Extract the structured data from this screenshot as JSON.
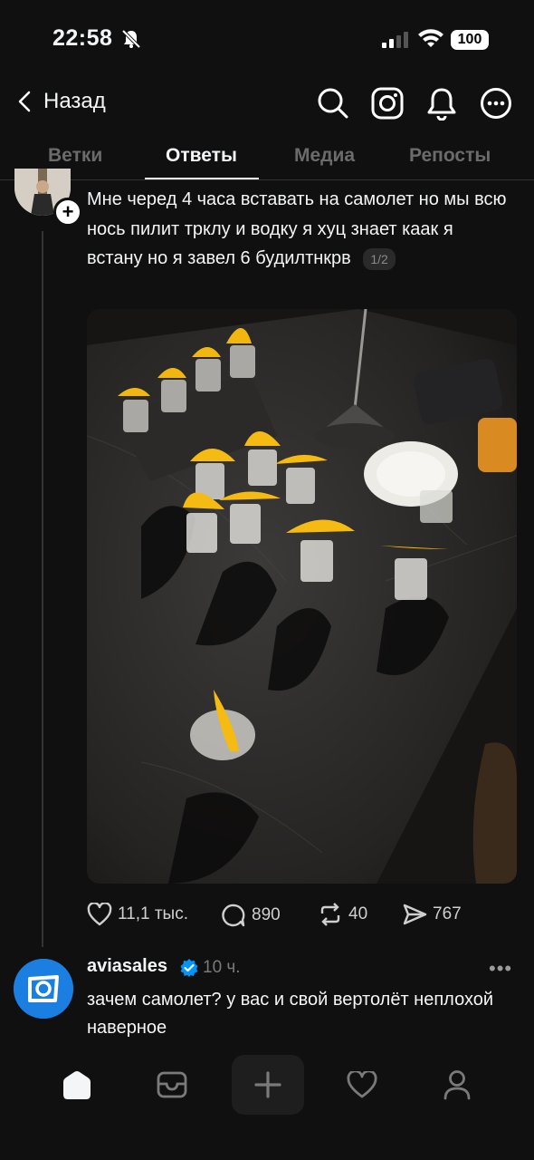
{
  "status_bar": {
    "time": "22:58",
    "battery": "100"
  },
  "header": {
    "back_label": "Назад"
  },
  "tabs": [
    {
      "label": "Ветки"
    },
    {
      "label": "Ответы"
    },
    {
      "label": "Медиа"
    },
    {
      "label": "Репосты"
    }
  ],
  "active_tab": "Ответы",
  "post": {
    "text": "Мне черед 4 часа вставать на самолет но мы всю нось пилит трклу и водку я хуц знает каак я встану но я завел 6 будилтнкрв",
    "page_indicator": "1/2",
    "likes": "11,1 тыс.",
    "comments": "890",
    "reposts": "40",
    "shares": "767"
  },
  "reply": {
    "username": "aviasales",
    "time": "10 ч.",
    "text": "зачем самолет? у вас и свой вертолёт неплохой наверное"
  },
  "colors": {
    "background": "#101010",
    "text": "#f3f5f7",
    "muted": "#6b6b6b",
    "verified": "#0095f6",
    "aviasales": "#1a7fe0"
  }
}
